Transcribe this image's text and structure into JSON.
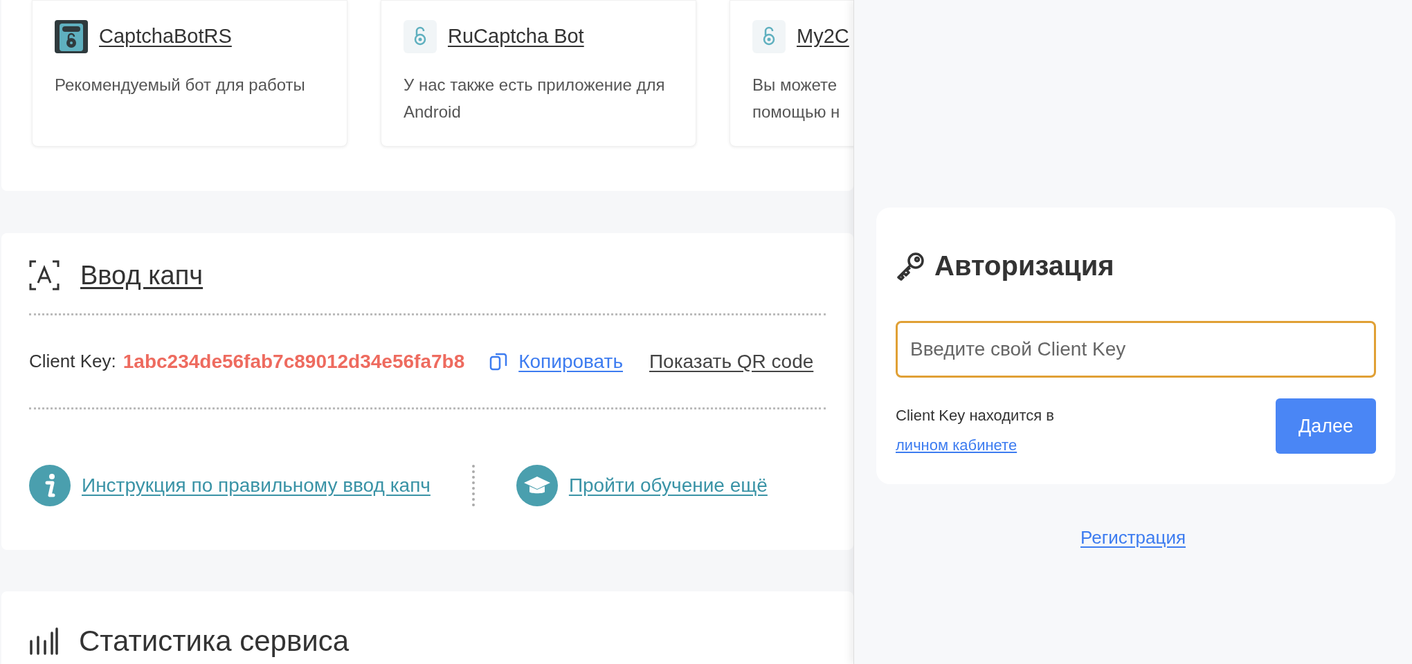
{
  "bots": [
    {
      "kind": "dark",
      "title": "CaptchaBotRS",
      "description": [
        "Рекомендуемый бот для работы"
      ]
    },
    {
      "kind": "light",
      "title": "RuCaptcha Bot",
      "description": [
        "У нас также есть приложение для",
        "Android"
      ]
    },
    {
      "kind": "light",
      "title": "My2C",
      "description": [
        "Вы можете",
        "помощью н"
      ]
    }
  ],
  "captcha_section": {
    "title": "Ввод капч",
    "client_key_label": "Client Key:",
    "client_key": "1abc234de56fab7c89012d34e56fa7b8",
    "copy_link": "Копировать",
    "qr_link": "Показать QR code",
    "links": [
      {
        "kind": "info",
        "label": "Инструкция по правильному ввод капч"
      },
      {
        "kind": "education",
        "label": "Пройти обучение ещё"
      }
    ]
  },
  "stats_section": {
    "title": "Статистика сервиса"
  },
  "auth_panel": {
    "title": "Авторизация",
    "input": {
      "placeholder": "Введите свой Client Key",
      "focused": true
    },
    "hint": "Client Key находится в",
    "hint_link": "личном кабинете",
    "submit": "Далее",
    "register_link": "Регистрация"
  }
}
